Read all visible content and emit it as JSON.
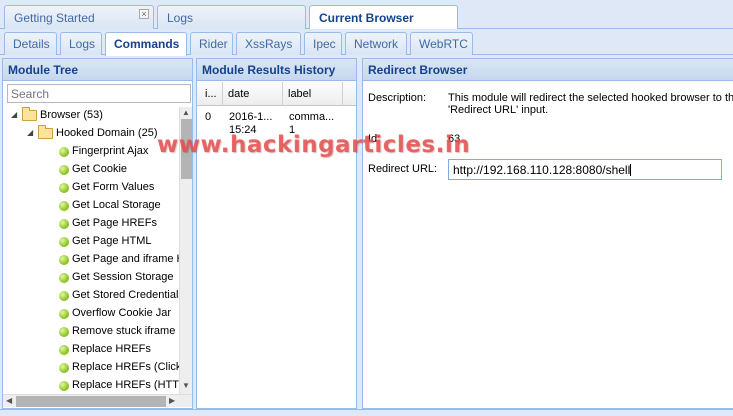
{
  "top_tabs": [
    {
      "label": "Getting Started",
      "active": false,
      "closable": true
    },
    {
      "label": "Logs",
      "active": false
    },
    {
      "label": "Current Browser",
      "active": true
    }
  ],
  "sub_tabs": [
    {
      "label": "Details"
    },
    {
      "label": "Logs"
    },
    {
      "label": "Commands",
      "active": true
    },
    {
      "label": "Rider"
    },
    {
      "label": "XssRays"
    },
    {
      "label": "Ipec"
    },
    {
      "label": "Network"
    },
    {
      "label": "WebRTC"
    }
  ],
  "module_tree": {
    "title": "Module Tree",
    "search_placeholder": "Search",
    "root": "Browser (53)",
    "folder": "Hooked Domain (25)",
    "items": [
      "Fingerprint Ajax",
      "Get Cookie",
      "Get Form Values",
      "Get Local Storage",
      "Get Page HREFs",
      "Get Page HTML",
      "Get Page and iframe H",
      "Get Session Storage",
      "Get Stored Credentials",
      "Overflow Cookie Jar",
      "Remove stuck iframe",
      "Replace HREFs",
      "Replace HREFs (Click",
      "Replace HREFs (HTT"
    ]
  },
  "results": {
    "title": "Module Results History",
    "columns": [
      "i...",
      "date",
      "label"
    ],
    "rows": [
      {
        "id": "0",
        "date_line1": "2016-1...",
        "date_line2": "15:24",
        "label_line1": "comma...",
        "label_line2": "1"
      }
    ]
  },
  "redirect": {
    "title": "Redirect Browser",
    "description_label": "Description:",
    "description_line1": "This module will redirect the selected hooked browser to the",
    "description_line2": "'Redirect URL' input.",
    "id_label": "Id:",
    "id_value": "63",
    "url_label": "Redirect URL:",
    "url_value": "http://192.168.110.128:8080/shell"
  },
  "watermark": "www.hackingarticles.in"
}
